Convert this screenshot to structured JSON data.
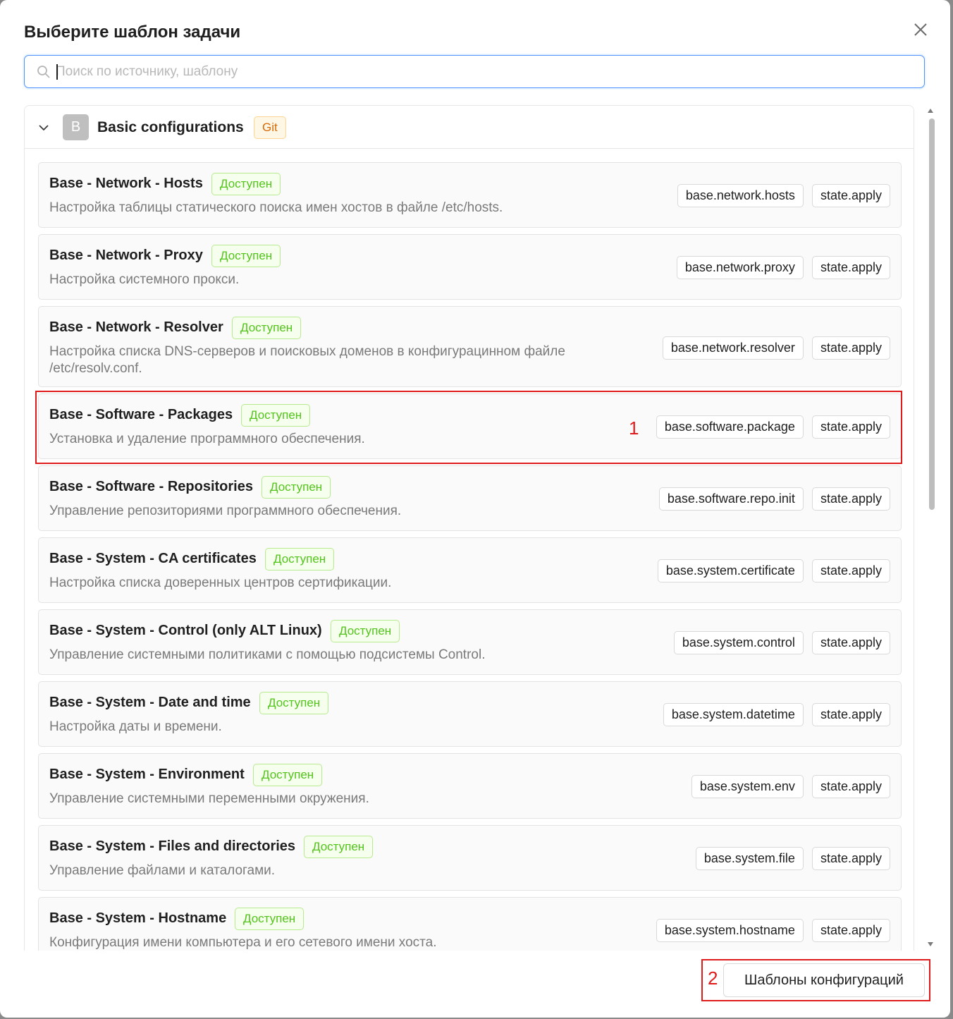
{
  "dialog": {
    "title": "Выберите шаблон задачи",
    "close_icon": "close-icon",
    "search": {
      "placeholder": "Поиск по источнику, шаблону",
      "value": ""
    }
  },
  "group": {
    "avatar": "B",
    "name": "Basic configurations",
    "tag": "Git",
    "expanded": true
  },
  "templates": [
    {
      "title": "Base - Network - Hosts",
      "status": "Доступен",
      "description": "Настройка таблицы статического поиска имен хостов в файле /etc/hosts.",
      "tags": [
        "base.network.hosts",
        "state.apply"
      ]
    },
    {
      "title": "Base - Network - Proxy",
      "status": "Доступен",
      "description": "Настройка системного прокси.",
      "tags": [
        "base.network.proxy",
        "state.apply"
      ]
    },
    {
      "title": "Base - Network - Resolver",
      "status": "Доступен",
      "description": "Настройка списка DNS-серверов и поисковых доменов в конфигурацинном файле /etc/resolv.conf.",
      "tags": [
        "base.network.resolver",
        "state.apply"
      ]
    },
    {
      "title": "Base - Software - Packages",
      "status": "Доступен",
      "description": "Установка и удаление программного обеспечения.",
      "tags": [
        "base.software.package",
        "state.apply"
      ]
    },
    {
      "title": "Base - Software - Repositories",
      "status": "Доступен",
      "description": "Управление репозиториями программного обеспечения.",
      "tags": [
        "base.software.repo.init",
        "state.apply"
      ]
    },
    {
      "title": "Base - System - CA certificates",
      "status": "Доступен",
      "description": "Настройка списка доверенных центров сертификации.",
      "tags": [
        "base.system.certificate",
        "state.apply"
      ]
    },
    {
      "title": "Base - System - Control (only ALT Linux)",
      "status": "Доступен",
      "description": "Управление системными политиками с помощью подсистемы Control.",
      "tags": [
        "base.system.control",
        "state.apply"
      ]
    },
    {
      "title": "Base - System - Date and time",
      "status": "Доступен",
      "description": "Настройка даты и времени.",
      "tags": [
        "base.system.datetime",
        "state.apply"
      ]
    },
    {
      "title": "Base - System - Environment",
      "status": "Доступен",
      "description": "Управление системными переменными окружения.",
      "tags": [
        "base.system.env",
        "state.apply"
      ]
    },
    {
      "title": "Base - System - Files and directories",
      "status": "Доступен",
      "description": "Управление файлами и каталогами.",
      "tags": [
        "base.system.file",
        "state.apply"
      ]
    },
    {
      "title": "Base - System - Hostname",
      "status": "Доступен",
      "description": "Конфигурация имени компьютера и его сетевого имени хоста.",
      "tags": [
        "base.system.hostname",
        "state.apply"
      ]
    }
  ],
  "annotations": {
    "marker1": "1",
    "marker2": "2"
  },
  "footer": {
    "config_templates_button": "Шаблоны конфигураций"
  },
  "colors": {
    "accent": "#4d90fe",
    "status_green": "#52c41a",
    "git_orange": "#d46b08",
    "highlight_red": "#e01b1b"
  }
}
